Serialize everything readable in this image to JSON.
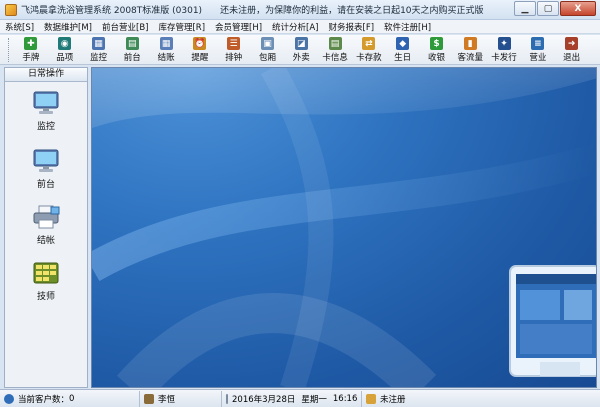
{
  "window": {
    "title": "飞鸿晨拿洗浴管理系统  2008T标准版 (0301)",
    "notice": "还未注册，为保障你的利益，请在安装之日起10天之内购买正式版",
    "min_label": "▁",
    "max_label": "▢",
    "close_label": "X"
  },
  "menu": [
    "系统[S]",
    "数据维护[M]",
    "前台营业[B]",
    "库存管理[R]",
    "会员管理[H]",
    "统计分析[A]",
    "财务报表[F]",
    "软件注册[H]"
  ],
  "toolbar": [
    {
      "label": "手牌",
      "icon": "plus-icon",
      "color": "#2f9a3a",
      "glyph": "✚"
    },
    {
      "label": "品项",
      "icon": "database-icon",
      "color": "#1f7a78",
      "glyph": "◉"
    },
    {
      "label": "监控",
      "icon": "monitor-grid-icon",
      "color": "#4b74b0",
      "glyph": "▦"
    },
    {
      "label": "前台",
      "icon": "table-icon",
      "color": "#3e8b58",
      "glyph": "▤"
    },
    {
      "label": "结账",
      "icon": "grid-icon",
      "color": "#5a7fb8",
      "glyph": "▦"
    },
    {
      "label": "提醒",
      "icon": "alarm-icon",
      "color": "#c98a1e",
      "glyph": "⏰"
    },
    {
      "label": "排钟",
      "icon": "list-icon",
      "color": "#c05c2a",
      "glyph": "☰"
    },
    {
      "label": "包厢",
      "icon": "room-icon",
      "color": "#6b8fb5",
      "glyph": "▣"
    },
    {
      "label": "外卖",
      "icon": "cart-icon",
      "color": "#4a74a6",
      "glyph": "◪"
    },
    {
      "label": "卡信息",
      "icon": "card-icon",
      "color": "#5d8a4a",
      "glyph": "▤"
    },
    {
      "label": "卡存款",
      "icon": "card-transfer-icon",
      "color": "#d49a2b",
      "glyph": "⇄"
    },
    {
      "label": "生日",
      "icon": "gift-icon",
      "color": "#2d63b0",
      "glyph": "◆"
    },
    {
      "label": "收银",
      "icon": "dollar-icon",
      "color": "#2f9a3a",
      "glyph": "$"
    },
    {
      "label": "客流量",
      "icon": "bar-chart-icon",
      "color": "#d07a24",
      "glyph": "▮"
    },
    {
      "label": "卡发行",
      "icon": "runner-icon",
      "color": "#24508f",
      "glyph": "✦"
    },
    {
      "label": "营业",
      "icon": "sliders-icon",
      "color": "#2c6cb0",
      "glyph": "≡"
    },
    {
      "label": "退出",
      "icon": "exit-door-icon",
      "color": "#a7402b",
      "glyph": "➜"
    }
  ],
  "left_panel": {
    "header": "日常操作",
    "items": [
      {
        "label": "监控",
        "icon": "monitor-icon"
      },
      {
        "label": "前台",
        "icon": "monitor-icon"
      },
      {
        "label": "结帐",
        "icon": "printer-icon"
      },
      {
        "label": "技师",
        "icon": "technician-board-icon"
      }
    ]
  },
  "status": {
    "customers_label": "当前客户数：",
    "customers_value": "0",
    "user": "李恒",
    "date": "2016年3月28日",
    "weekday": "星期一",
    "time": "16:16",
    "registration": "未注册"
  }
}
